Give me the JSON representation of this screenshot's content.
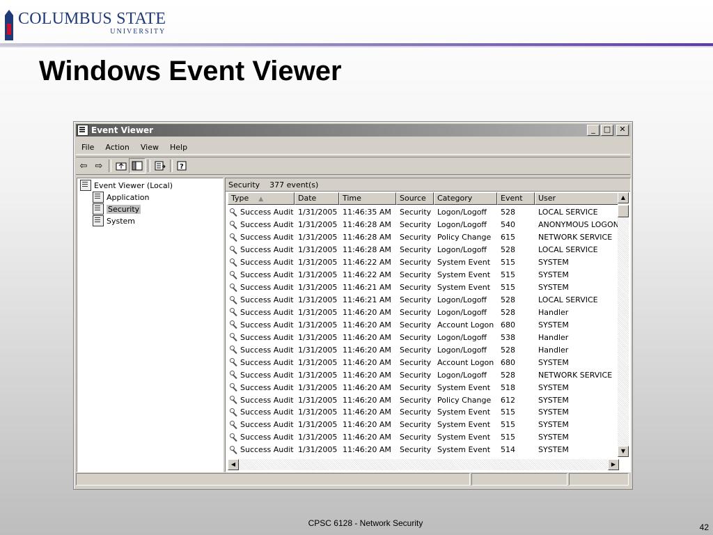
{
  "slide": {
    "logo_title": "COLUMBUS STATE",
    "logo_subtitle": "UNIVERSITY",
    "title": "Windows Event Viewer",
    "footer": "CPSC 6128 - Network Security",
    "page_number": "42"
  },
  "window": {
    "title": "Event Viewer",
    "caption_buttons": {
      "minimize": "_",
      "maximize": "□",
      "close": "✕"
    },
    "menu": [
      "File",
      "Action",
      "View",
      "Help"
    ],
    "toolbar_icons": [
      "back-icon",
      "forward-icon",
      "up-folder-icon",
      "show-hide-tree-icon",
      "export-list-icon",
      "help-icon"
    ]
  },
  "tree": {
    "root": "Event Viewer (Local)",
    "items": [
      "Application",
      "Security",
      "System"
    ],
    "selected": "Security"
  },
  "pane": {
    "log_name": "Security",
    "event_count": "377 event(s)"
  },
  "columns": [
    "Type",
    "Date",
    "Time",
    "Source",
    "Category",
    "Event",
    "User"
  ],
  "rows": [
    [
      "Success Audit",
      "1/31/2005",
      "11:46:35 AM",
      "Security",
      "Logon/Logoff",
      "528",
      "LOCAL SERVICE"
    ],
    [
      "Success Audit",
      "1/31/2005",
      "11:46:28 AM",
      "Security",
      "Logon/Logoff",
      "540",
      "ANONYMOUS LOGON"
    ],
    [
      "Success Audit",
      "1/31/2005",
      "11:46:28 AM",
      "Security",
      "Policy Change",
      "615",
      "NETWORK SERVICE"
    ],
    [
      "Success Audit",
      "1/31/2005",
      "11:46:28 AM",
      "Security",
      "Logon/Logoff",
      "528",
      "LOCAL SERVICE"
    ],
    [
      "Success Audit",
      "1/31/2005",
      "11:46:22 AM",
      "Security",
      "System Event",
      "515",
      "SYSTEM"
    ],
    [
      "Success Audit",
      "1/31/2005",
      "11:46:22 AM",
      "Security",
      "System Event",
      "515",
      "SYSTEM"
    ],
    [
      "Success Audit",
      "1/31/2005",
      "11:46:21 AM",
      "Security",
      "System Event",
      "515",
      "SYSTEM"
    ],
    [
      "Success Audit",
      "1/31/2005",
      "11:46:21 AM",
      "Security",
      "Logon/Logoff",
      "528",
      "LOCAL SERVICE"
    ],
    [
      "Success Audit",
      "1/31/2005",
      "11:46:20 AM",
      "Security",
      "Logon/Logoff",
      "528",
      "Handler"
    ],
    [
      "Success Audit",
      "1/31/2005",
      "11:46:20 AM",
      "Security",
      "Account Logon",
      "680",
      "SYSTEM"
    ],
    [
      "Success Audit",
      "1/31/2005",
      "11:46:20 AM",
      "Security",
      "Logon/Logoff",
      "538",
      "Handler"
    ],
    [
      "Success Audit",
      "1/31/2005",
      "11:46:20 AM",
      "Security",
      "Logon/Logoff",
      "528",
      "Handler"
    ],
    [
      "Success Audit",
      "1/31/2005",
      "11:46:20 AM",
      "Security",
      "Account Logon",
      "680",
      "SYSTEM"
    ],
    [
      "Success Audit",
      "1/31/2005",
      "11:46:20 AM",
      "Security",
      "Logon/Logoff",
      "528",
      "NETWORK SERVICE"
    ],
    [
      "Success Audit",
      "1/31/2005",
      "11:46:20 AM",
      "Security",
      "System Event",
      "518",
      "SYSTEM"
    ],
    [
      "Success Audit",
      "1/31/2005",
      "11:46:20 AM",
      "Security",
      "Policy Change",
      "612",
      "SYSTEM"
    ],
    [
      "Success Audit",
      "1/31/2005",
      "11:46:20 AM",
      "Security",
      "System Event",
      "515",
      "SYSTEM"
    ],
    [
      "Success Audit",
      "1/31/2005",
      "11:46:20 AM",
      "Security",
      "System Event",
      "515",
      "SYSTEM"
    ],
    [
      "Success Audit",
      "1/31/2005",
      "11:46:20 AM",
      "Security",
      "System Event",
      "515",
      "SYSTEM"
    ],
    [
      "Success Audit",
      "1/31/2005",
      "11:46:20 AM",
      "Security",
      "System Event",
      "514",
      "SYSTEM"
    ]
  ]
}
